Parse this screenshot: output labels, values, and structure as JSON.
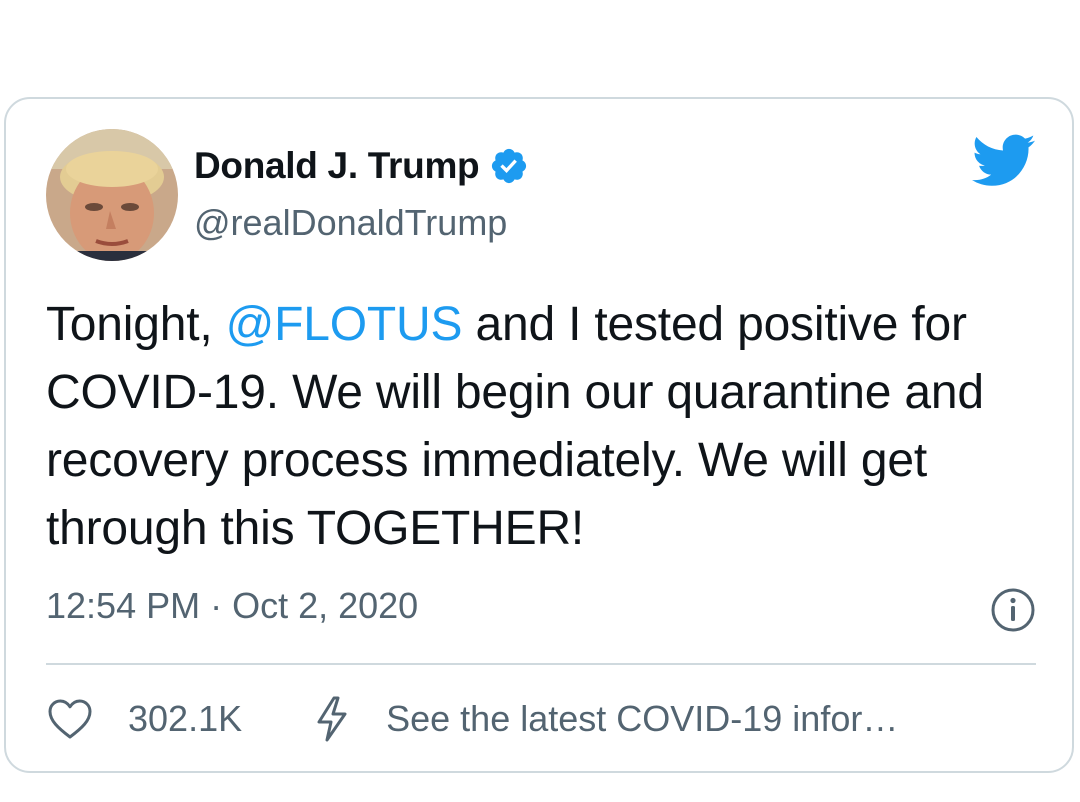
{
  "tweet": {
    "author": {
      "display_name": "Donald J. Trump",
      "handle": "@realDonaldTrump",
      "verified": true,
      "avatar_icon": "avatar-photo"
    },
    "text_parts": {
      "before_mention": "Tonight, ",
      "mention": "@FLOTUS",
      "after_mention": " and I tested positive for COVID-19. We will begin our quarantine and recovery process immediately. We will get through this TOGETHER!"
    },
    "timestamp": "12:54 PM · Oct 2, 2020",
    "like_count": "302.1K",
    "covid_link_label": "See the latest COVID-19 infor…"
  },
  "icons": {
    "brand": "twitter-bird-icon",
    "verified": "verified-badge-icon",
    "info": "info-icon",
    "like": "heart-icon",
    "covid": "lightning-bolt-icon"
  },
  "colors": {
    "brand": "#1d9bf0",
    "text_primary": "#0f1419",
    "text_secondary": "#536471",
    "border": "#cfd9de"
  }
}
